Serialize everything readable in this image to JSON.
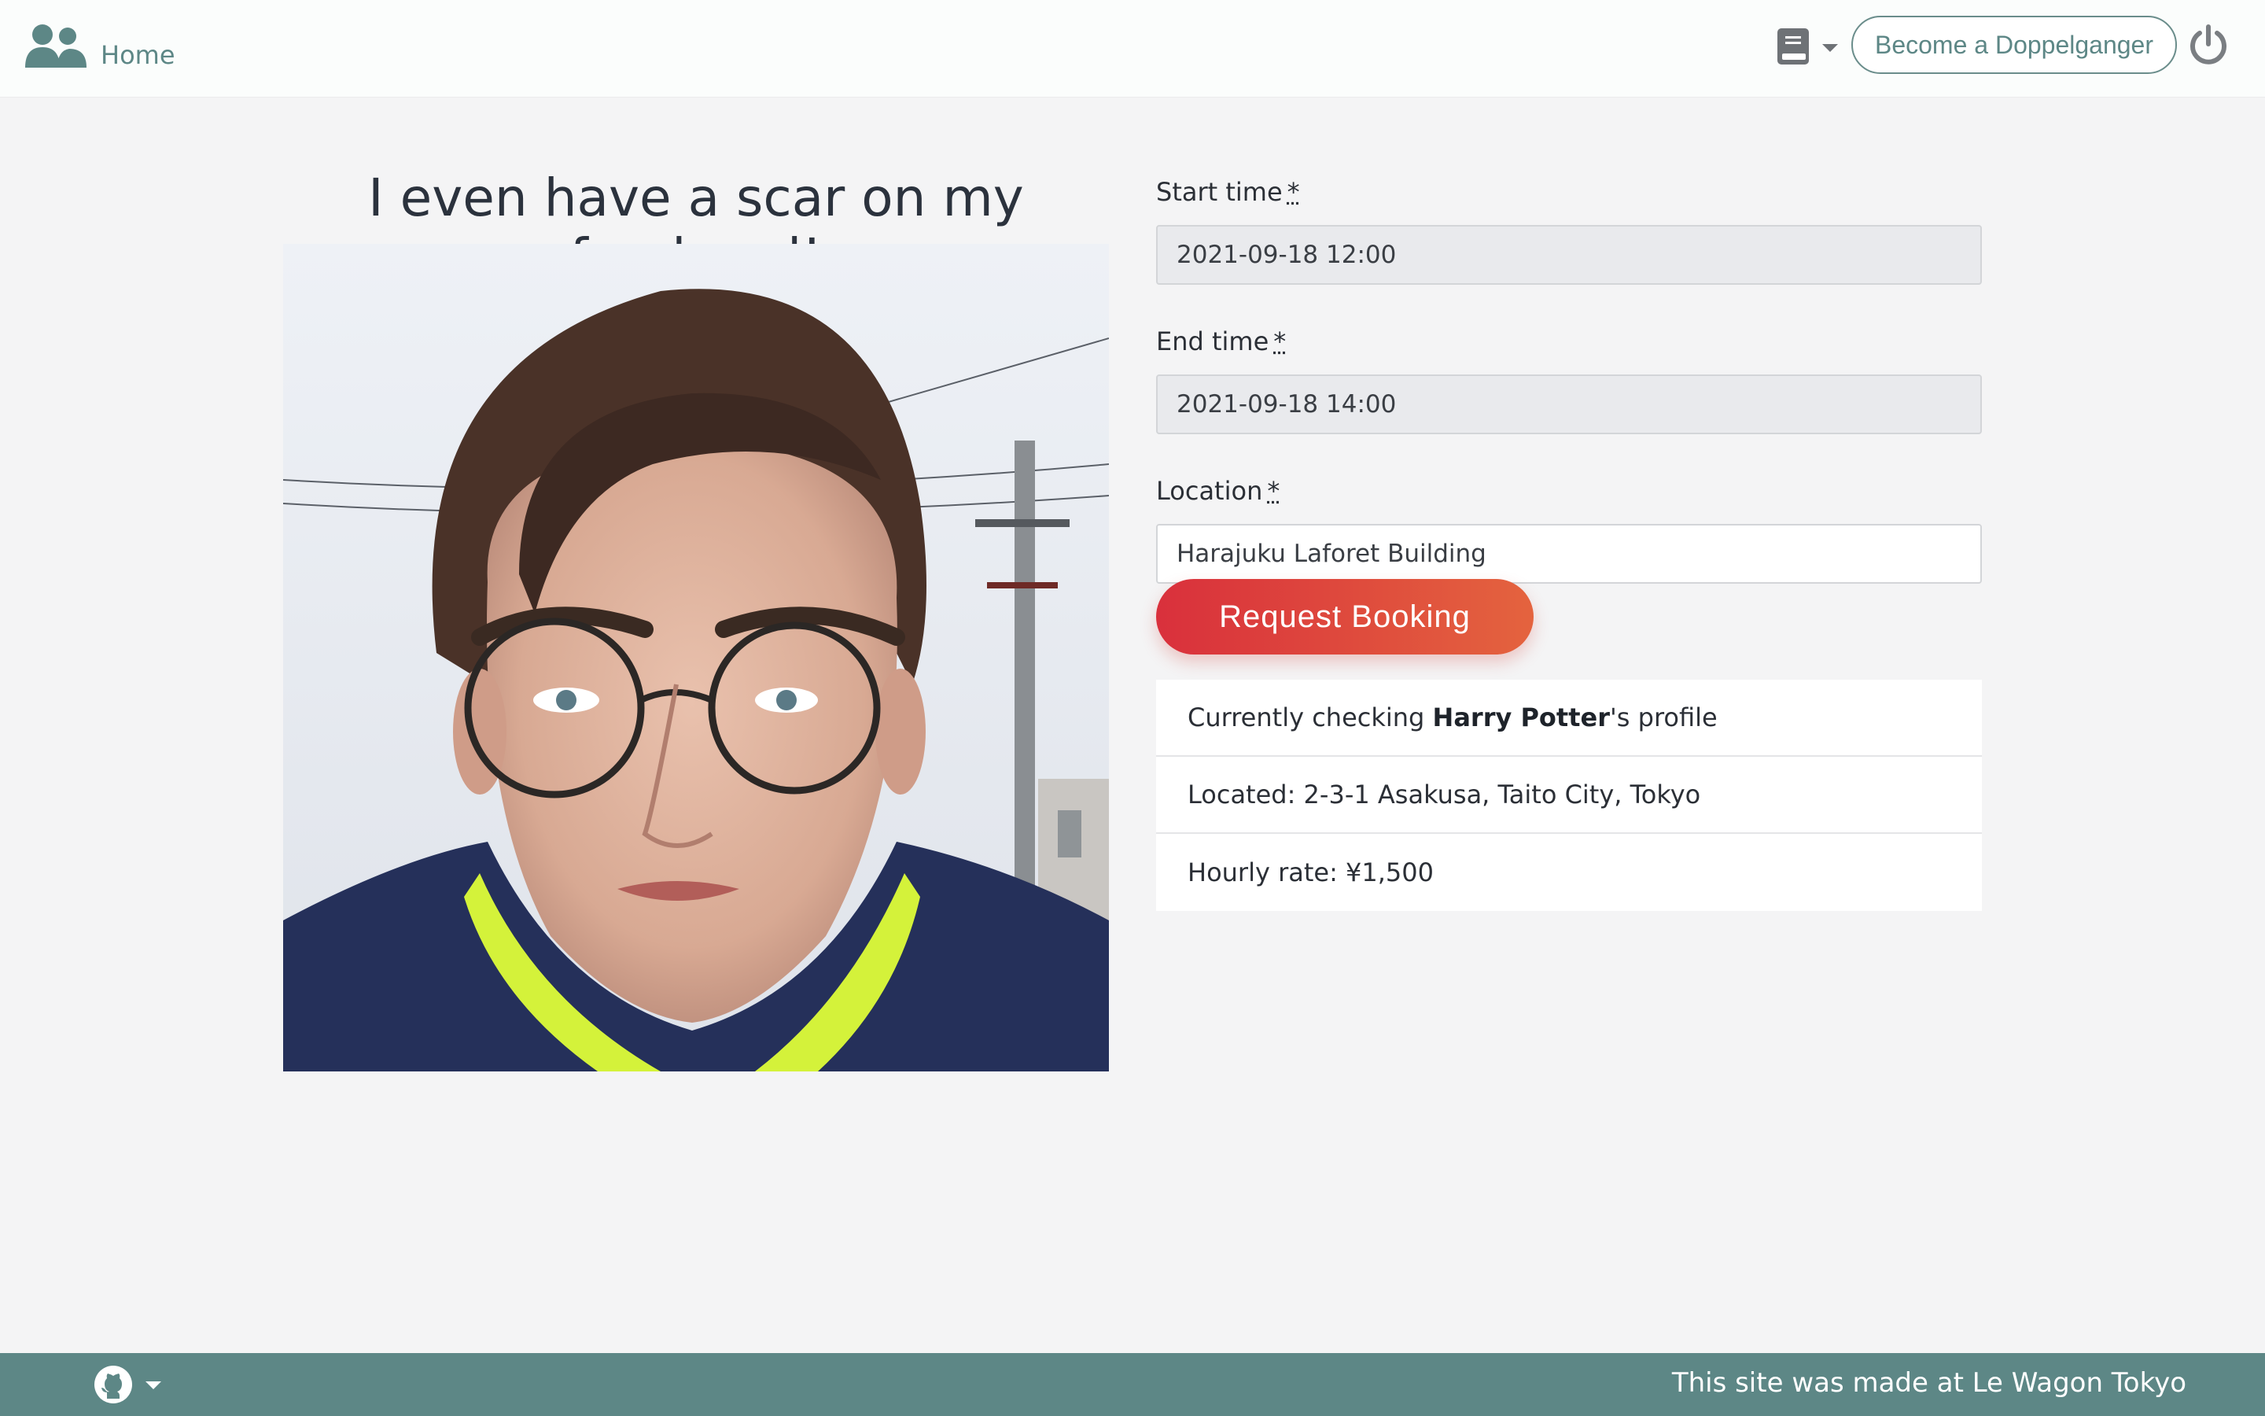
{
  "navbar": {
    "home_label": "Home",
    "become_label": "Become a Doppelganger",
    "icons": [
      "users-icon",
      "book-icon",
      "caret-down-icon",
      "power-icon"
    ]
  },
  "main": {
    "headline": "I even have a scar on my forehead!",
    "photo_name": "profile-photo"
  },
  "form": {
    "start_label": "Start time",
    "start_value": "2021-09-18 12:00",
    "end_label": "End time",
    "end_value": "2021-09-18 14:00",
    "location_label": "Location",
    "location_value": "Harajuku Laforet Building",
    "required_mark": "*",
    "submit_label": "Request Booking"
  },
  "info": {
    "checking_prefix": "Currently checking ",
    "checking_name": "Harry Potter",
    "checking_suffix": "'s profile",
    "located": "Located: 2-3-1 Asakusa, Taito City, Tokyo",
    "rate": "Hourly rate: ¥1,500"
  },
  "footer": {
    "credit": "This site was made at Le Wagon Tokyo"
  },
  "colors": {
    "teal": "#5d8786",
    "button_start": "#d9303c",
    "button_end": "#e4633e",
    "background": "#f4f4f5"
  }
}
